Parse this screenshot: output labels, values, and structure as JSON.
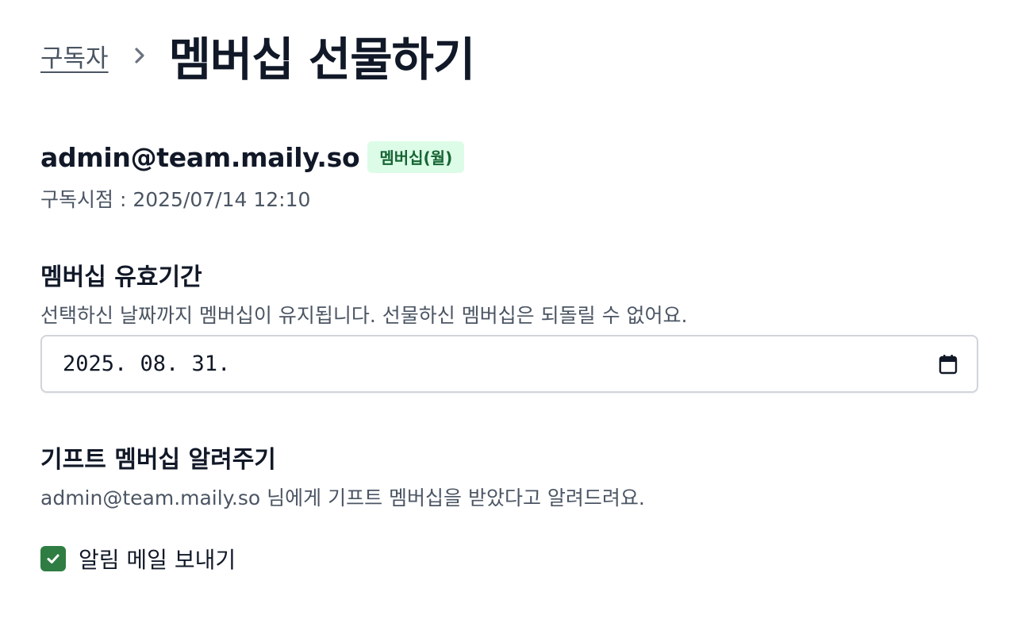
{
  "breadcrumb": {
    "parent_label": "구독자",
    "title": "멤버십 선물하기"
  },
  "subscriber": {
    "email": "admin@team.maily.so",
    "badge": "멤버십(월)",
    "subscribed_at": "구독시점 : 2025/07/14 12:10"
  },
  "validity": {
    "title": "멤버십 유효기간",
    "description": "선택하신 날짜까지 멤버십이 유지됩니다. 선물하신 멤버십은 되돌릴 수 없어요.",
    "date_value": "2025. 08. 31."
  },
  "notify": {
    "title": "기프트 멤버십 알려주기",
    "description": "admin@team.maily.so 님에게 기프트 멤버십을 받았다고 알려드려요.",
    "checkbox_label": "알림 메일 보내기",
    "checked": true
  },
  "colors": {
    "accent_green": "#2f7d43",
    "badge_bg": "#dcfce7",
    "badge_text": "#166534"
  },
  "icons": {
    "separator": "chevron-right-icon",
    "date_picker": "calendar-icon",
    "checkbox": "checkmark-icon"
  }
}
